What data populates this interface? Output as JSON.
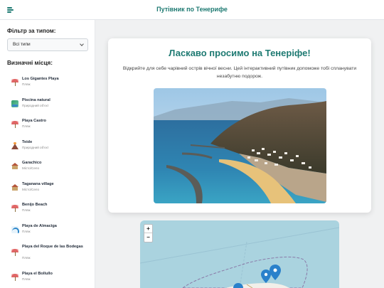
{
  "header": {
    "title": "Путівник по Тенерифе",
    "menu_icon": "menu-icon"
  },
  "sidebar": {
    "filter_label": "Фільтр за типом:",
    "filter_value": "Всі типи",
    "places_label": "Визначні місця:",
    "items": [
      {
        "name": "Los Gigantes Playa",
        "type": "Пляж",
        "icon": "beach-umbrella-icon"
      },
      {
        "name": "Piscina natural",
        "type": "Природний об'єкт",
        "icon": "natural-pool-icon"
      },
      {
        "name": "Playa Castro",
        "type": "Пляж",
        "icon": "beach-umbrella-icon"
      },
      {
        "name": "Teide",
        "type": "Природний об'єкт",
        "icon": "volcano-icon"
      },
      {
        "name": "Garachico",
        "type": "Місто/Село",
        "icon": "village-icon"
      },
      {
        "name": "Taganana village",
        "type": "Місто/Село",
        "icon": "village-icon"
      },
      {
        "name": "Benijo Beach",
        "type": "Пляж",
        "icon": "beach-umbrella-icon"
      },
      {
        "name": "Playa de Almaciga",
        "type": "Пляж",
        "icon": "wave-icon"
      },
      {
        "name": "Playa del Roque de las Bodegas",
        "type": "Пляж",
        "icon": "beach-umbrella-icon"
      },
      {
        "name": "Playa el Bollullo",
        "type": "Пляж",
        "icon": "beach-umbrella-icon"
      }
    ]
  },
  "welcome": {
    "title": "Ласкаво просимо на Тенеріфе!",
    "text": "Відкрийте для себе чарівний острів вічної весни. Цей інтерактивний путівник допоможе тобі спланувати незабутню подорож."
  },
  "map": {
    "zoom_in": "+",
    "zoom_out": "−"
  },
  "colors": {
    "accent": "#1e7a72",
    "map_water": "#aad3df",
    "marker": "#2a81cb"
  }
}
